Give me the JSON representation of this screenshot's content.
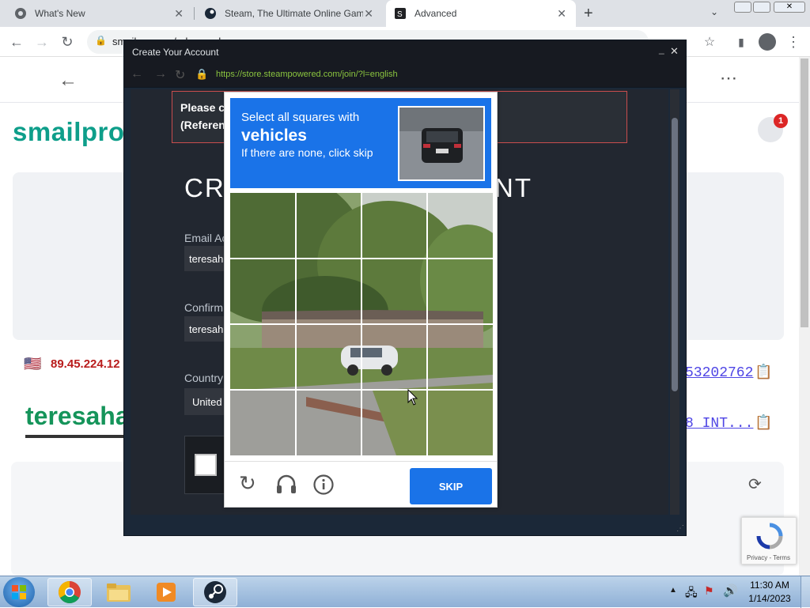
{
  "browser": {
    "tabs": [
      {
        "title": "What's New"
      },
      {
        "title": "Steam, The Ultimate Online Game"
      },
      {
        "title": "Advanced"
      }
    ],
    "address_partial": "smailpro.com/advanced"
  },
  "background_page": {
    "logo": "smailpro",
    "notification_count": "1",
    "ip_address": "89.45.224.12",
    "phone_partial": "53202762",
    "email_partial": "teresaha",
    "label_partial": "8 INT..."
  },
  "steam_window": {
    "title": "Create Your Account",
    "url": "https://store.steampowered.com/join/?l=english",
    "notice_line1": "Please c",
    "notice_line2": "(Referen",
    "heading_left": "CRE",
    "heading_right": "NT",
    "email_label": "Email Ac",
    "email_value": "teresah",
    "confirm_label": "Confirm",
    "confirm_value": "teresah",
    "country_label": "Country",
    "country_value": "United"
  },
  "captcha": {
    "instruction": "Select all squares with",
    "target": "vehicles",
    "hint": "If there are none, click skip",
    "skip_label": "SKIP"
  },
  "recaptcha": {
    "links": "Privacy - Terms"
  },
  "taskbar": {
    "time": "11:30 AM",
    "date": "1/14/2023"
  }
}
